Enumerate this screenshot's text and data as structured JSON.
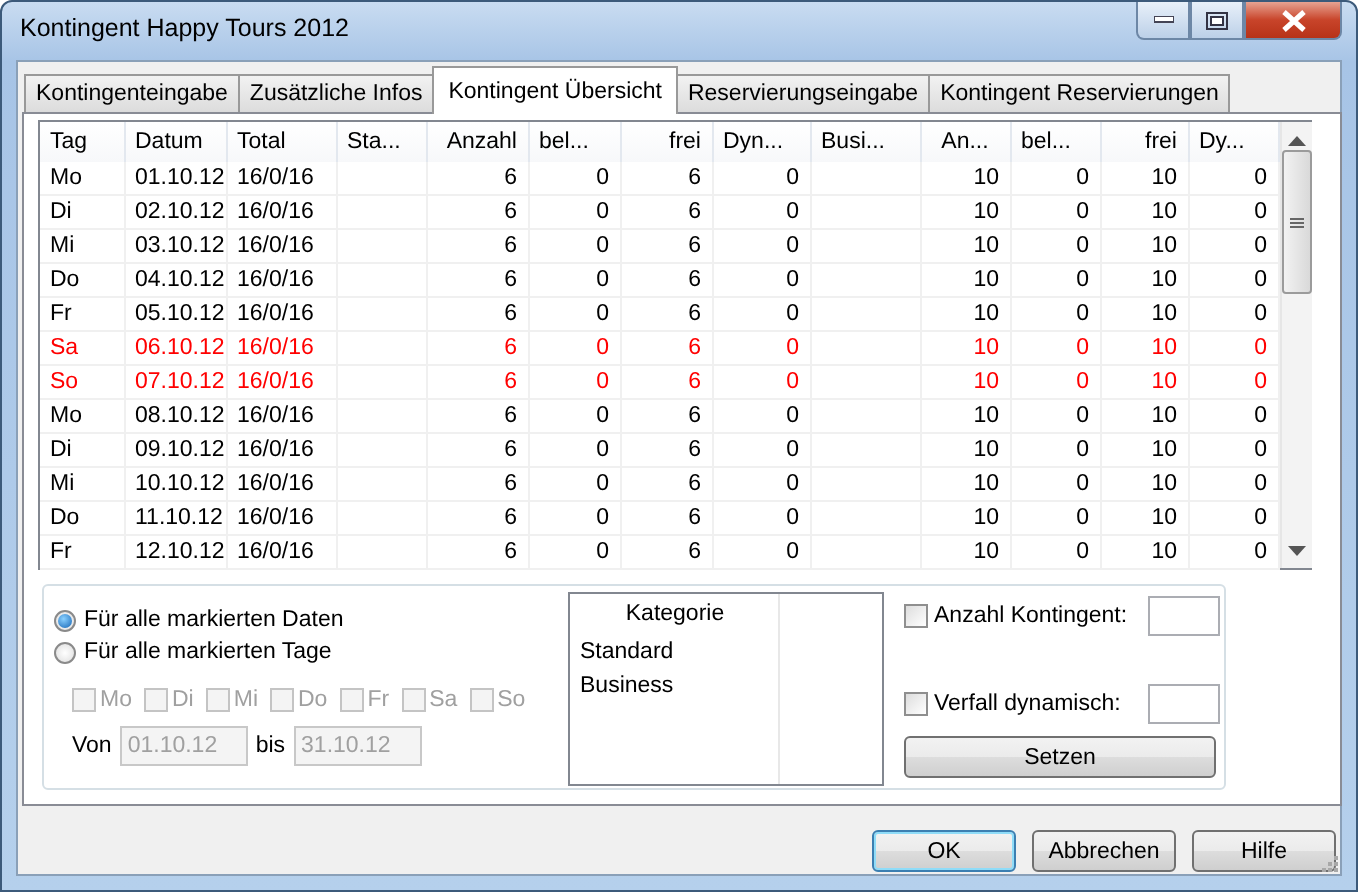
{
  "window": {
    "title": "Kontingent Happy Tours 2012"
  },
  "tabs": [
    {
      "label": "Kontingenteingabe",
      "selected": false
    },
    {
      "label": "Zusätzliche Infos",
      "selected": false
    },
    {
      "label": "Kontingent Übersicht",
      "selected": true
    },
    {
      "label": "Reservierungseingabe",
      "selected": false
    },
    {
      "label": "Kontingent Reservierungen",
      "selected": false
    }
  ],
  "grid": {
    "columns": [
      "Tag",
      "Datum",
      "Total",
      "Sta...",
      "Anzahl",
      "bel...",
      "frei",
      "Dyn...",
      "Busi...",
      "An...",
      "bel...",
      "frei",
      "Dy..."
    ],
    "rows": [
      {
        "highlighted": false,
        "cells": [
          "Mo",
          "01.10.12",
          "16/0/16",
          null,
          "6",
          "0",
          "6",
          "0",
          null,
          "10",
          "0",
          "10",
          "0"
        ]
      },
      {
        "highlighted": false,
        "cells": [
          "Di",
          "02.10.12",
          "16/0/16",
          null,
          "6",
          "0",
          "6",
          "0",
          null,
          "10",
          "0",
          "10",
          "0"
        ]
      },
      {
        "highlighted": false,
        "cells": [
          "Mi",
          "03.10.12",
          "16/0/16",
          null,
          "6",
          "0",
          "6",
          "0",
          null,
          "10",
          "0",
          "10",
          "0"
        ]
      },
      {
        "highlighted": false,
        "cells": [
          "Do",
          "04.10.12",
          "16/0/16",
          null,
          "6",
          "0",
          "6",
          "0",
          null,
          "10",
          "0",
          "10",
          "0"
        ]
      },
      {
        "highlighted": false,
        "cells": [
          "Fr",
          "05.10.12",
          "16/0/16",
          null,
          "6",
          "0",
          "6",
          "0",
          null,
          "10",
          "0",
          "10",
          "0"
        ]
      },
      {
        "highlighted": true,
        "cells": [
          "Sa",
          "06.10.12",
          "16/0/16",
          null,
          "6",
          "0",
          "6",
          "0",
          null,
          "10",
          "0",
          "10",
          "0"
        ]
      },
      {
        "highlighted": true,
        "cells": [
          "So",
          "07.10.12",
          "16/0/16",
          null,
          "6",
          "0",
          "6",
          "0",
          null,
          "10",
          "0",
          "10",
          "0"
        ]
      },
      {
        "highlighted": false,
        "cells": [
          "Mo",
          "08.10.12",
          "16/0/16",
          null,
          "6",
          "0",
          "6",
          "0",
          null,
          "10",
          "0",
          "10",
          "0"
        ]
      },
      {
        "highlighted": false,
        "cells": [
          "Di",
          "09.10.12",
          "16/0/16",
          null,
          "6",
          "0",
          "6",
          "0",
          null,
          "10",
          "0",
          "10",
          "0"
        ]
      },
      {
        "highlighted": false,
        "cells": [
          "Mi",
          "10.10.12",
          "16/0/16",
          null,
          "6",
          "0",
          "6",
          "0",
          null,
          "10",
          "0",
          "10",
          "0"
        ]
      },
      {
        "highlighted": false,
        "cells": [
          "Do",
          "11.10.12",
          "16/0/16",
          null,
          "6",
          "0",
          "6",
          "0",
          null,
          "10",
          "0",
          "10",
          "0"
        ]
      },
      {
        "highlighted": false,
        "cells": [
          "Fr",
          "12.10.12",
          "16/0/16",
          null,
          "6",
          "0",
          "6",
          "0",
          null,
          "10",
          "0",
          "10",
          "0"
        ]
      }
    ]
  },
  "options": {
    "radios": [
      {
        "label": "Für alle markierten Daten",
        "selected": true
      },
      {
        "label": "Für alle markierten Tage",
        "selected": false
      }
    ],
    "days": [
      {
        "label": "Mo",
        "checked": false,
        "disabled": true
      },
      {
        "label": "Di",
        "checked": false,
        "disabled": true
      },
      {
        "label": "Mi",
        "checked": false,
        "disabled": true
      },
      {
        "label": "Do",
        "checked": false,
        "disabled": true
      },
      {
        "label": "Fr",
        "checked": false,
        "disabled": true
      },
      {
        "label": "Sa",
        "checked": false,
        "disabled": true
      },
      {
        "label": "So",
        "checked": false,
        "disabled": true
      }
    ],
    "from_label": "Von",
    "from": {
      "value": "01.10.12",
      "disabled": true
    },
    "to_label": "bis",
    "to": {
      "value": "31.10.12",
      "disabled": true
    }
  },
  "categories": {
    "column": "Kategorie",
    "items": [
      "Standard",
      "Business"
    ]
  },
  "settings": {
    "checks": [
      {
        "label": "Anzahl Kontingent:",
        "checked": false
      },
      {
        "label": "Verfall dynamisch:",
        "checked": false
      }
    ],
    "apply_button": "Setzen"
  },
  "buttons": [
    "OK",
    "Abbrechen",
    "Hilfe"
  ]
}
